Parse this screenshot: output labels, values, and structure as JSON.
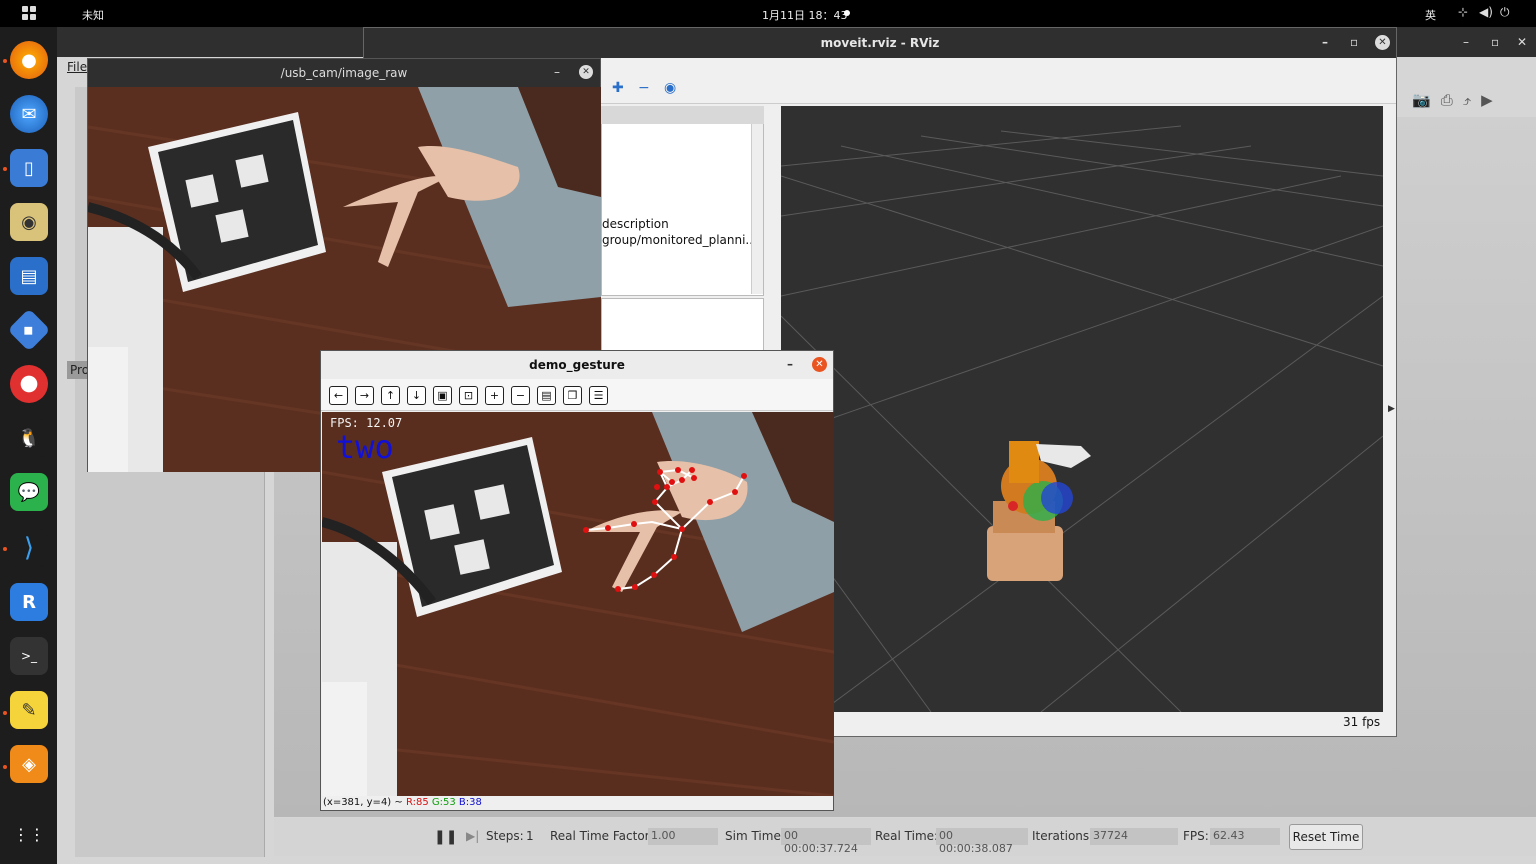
{
  "topbar": {
    "left_text": "未知",
    "clock": "1月11日 18：43",
    "lang": "英"
  },
  "gazebo": {
    "menu_file": "File",
    "panel_label": "Pro",
    "bottom": {
      "steps_label": "Steps:",
      "steps_value": "1",
      "rtf_label": "Real Time Factor:",
      "rtf_value": "1.00",
      "sim_time_label": "Sim Time:",
      "sim_time_value": "00 00:00:37.724",
      "real_time_label": "Real Time:",
      "real_time_value": "00 00:00:38.087",
      "iterations_label": "Iterations:",
      "iterations_value": "37724",
      "fps_label": "FPS:",
      "fps_value": "62.43",
      "reset_label": "Reset Time"
    }
  },
  "rviz": {
    "title": "moveit.rviz - RViz",
    "panel_lines": [
      "description",
      "group/monitored_planni..."
    ],
    "fps": "31 fps"
  },
  "usb_cam": {
    "title": "/usb_cam/image_raw"
  },
  "demo_gesture": {
    "title": "demo_gesture",
    "overlay_fps": "FPS: 12.07",
    "overlay_gesture": "two",
    "status_pos": "(x=381, y=4) ~",
    "status_r": "R:85",
    "status_g": "G:53",
    "status_b": "B:38"
  }
}
